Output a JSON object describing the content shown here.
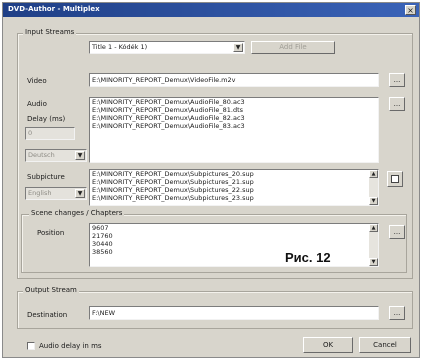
{
  "window": {
    "title": "DVD-Author - Multiplex",
    "close_glyph": "×"
  },
  "input_streams": {
    "label": "Input Streams",
    "title_combo": "Title 1 - Kódék 1)",
    "add_button": "Add File",
    "video_label": "Video",
    "video_path": "E:\\MINORITY_REPORT_Demux\\VideoFile.m2v",
    "audio_label": "Audio",
    "audio_files": [
      "E:\\MINORITY_REPORT_Demux\\AudioFile_80.ac3",
      "E:\\MINORITY_REPORT_Demux\\AudioFile_81.dts",
      "E:\\MINORITY_REPORT_Demux\\AudioFile_82.ac3",
      "E:\\MINORITY_REPORT_Demux\\AudioFile_83.ac3"
    ],
    "delay_label": "Delay (ms)",
    "delay_value": "0",
    "language_combo": "Deutsch",
    "subpicture_label": "Subpicture",
    "subpicture_combo": "English",
    "subpicture_files": [
      "E:\\MINORITY_REPORT_Demux\\Subpictures_20.sup",
      "E:\\MINORITY_REPORT_Demux\\Subpictures_21.sup",
      "E:\\MINORITY_REPORT_Demux\\Subpictures_22.sup",
      "E:\\MINORITY_REPORT_Demux\\Subpictures_23.sup"
    ],
    "browse_glyph": "...",
    "scroll_up": "▲",
    "scroll_down": "▼",
    "combo_arrow": "▼"
  },
  "scene_changes": {
    "label": "Scene changes / Chapters",
    "position_label": "Position",
    "positions": [
      "9607",
      "21760",
      "30440",
      "38560"
    ]
  },
  "figure_caption": "Рис. 12",
  "output_streams": {
    "label": "Output Stream",
    "destination_label": "Destination",
    "destination_value": "F:\\NEW"
  },
  "footer": {
    "audio_delay_label": "Audio delay in ms",
    "ok_button": "OK",
    "cancel_button": "Cancel"
  },
  "colors": {
    "title_bar": "#2b4d9b",
    "dialog_bg": "#d8d5cc"
  }
}
